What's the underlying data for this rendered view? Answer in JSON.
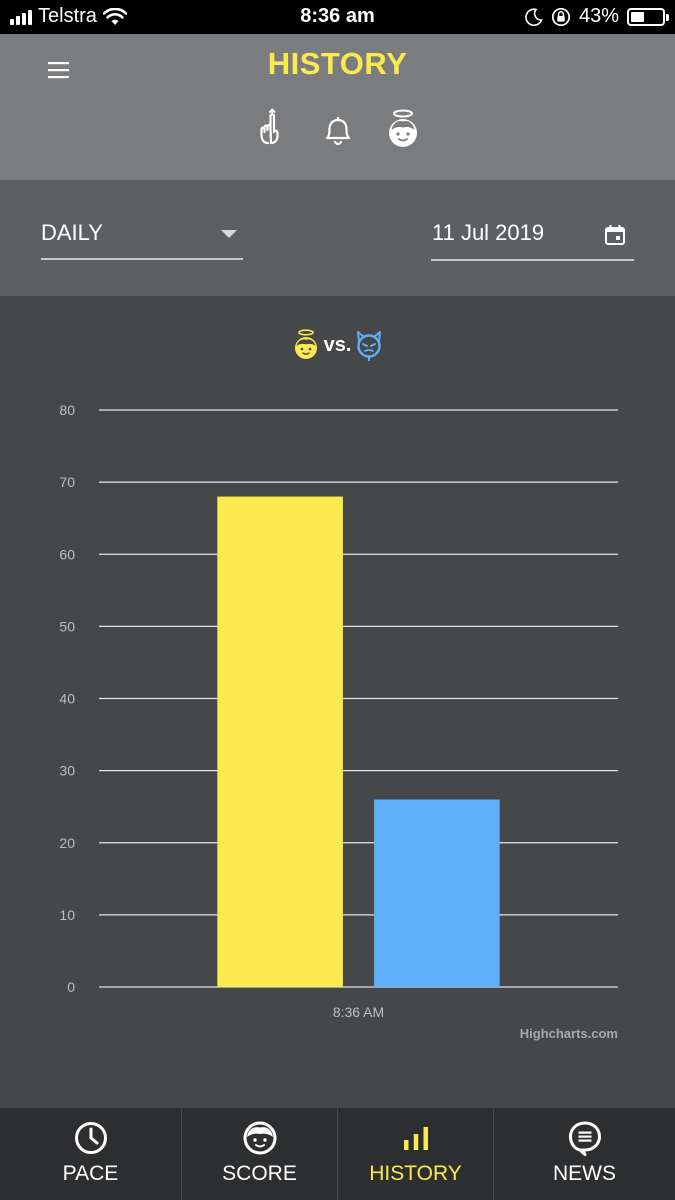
{
  "status_bar": {
    "carrier": "Telstra",
    "time": "8:36 am",
    "battery_percent": "43%",
    "battery_level": 0.43,
    "icons": [
      "signal-icon",
      "wifi-icon",
      "moon-icon",
      "orientation-lock-icon",
      "battery-icon"
    ]
  },
  "header": {
    "title": "HISTORY",
    "icons": [
      "menu-icon",
      "hand-pointer-icon",
      "bell-icon",
      "angel-face-icon"
    ]
  },
  "filters": {
    "period": "DAILY",
    "date": "11 Jul 2019",
    "icons": [
      "dropdown-caret-icon",
      "calendar-icon"
    ]
  },
  "chart_heading": {
    "vs_text": "vs.",
    "icons": [
      "angel-face-icon",
      "devil-face-icon"
    ]
  },
  "chart_data": {
    "type": "bar",
    "categories": [
      "8:36 AM"
    ],
    "series": [
      {
        "values": [
          68
        ],
        "color": "#fce94e"
      },
      {
        "values": [
          26
        ],
        "color": "#5eb1f9"
      }
    ],
    "ylim": [
      0,
      80
    ],
    "yticks": [
      0,
      10,
      20,
      30,
      40,
      50,
      60,
      70,
      80
    ],
    "grid": true,
    "credit": "Highcharts.com"
  },
  "tabs": [
    {
      "label": "PACE",
      "icon": "clock-icon",
      "active": false
    },
    {
      "label": "SCORE",
      "icon": "face-icon",
      "active": false
    },
    {
      "label": "HISTORY",
      "icon": "bar-chart-icon",
      "active": true
    },
    {
      "label": "NEWS",
      "icon": "chat-bubble-icon",
      "active": false
    }
  ],
  "colors": {
    "accent": "#fce94e",
    "opponent": "#5eb1f9",
    "header_bg": "#7b7c7d",
    "filter_bg": "#5d6063",
    "chart_bg": "#464748",
    "tabbar_bg": "#2d2e2f"
  }
}
